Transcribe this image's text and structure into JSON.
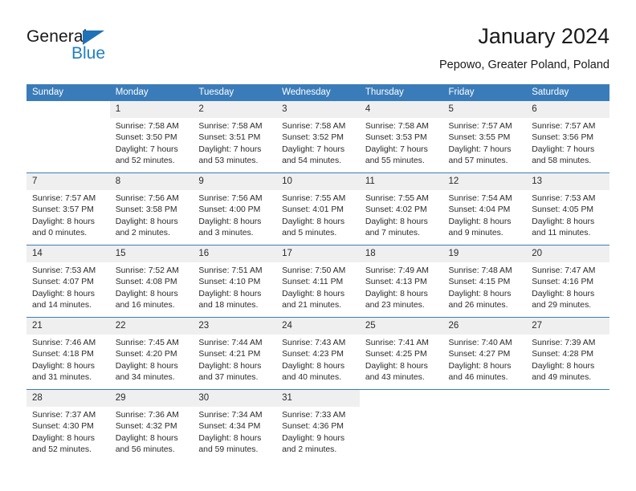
{
  "brand": {
    "name_part1": "General",
    "name_part2": "Blue",
    "triangle_icon": "triangle-icon",
    "accent_color": "#1f7fc4"
  },
  "header": {
    "title": "January 2024",
    "subtitle": "Pepowo, Greater Poland, Poland"
  },
  "theme": {
    "header_row_color": "#3a7cb9",
    "daynum_band_color": "#efefef",
    "text_color": "#2a2a2a"
  },
  "calendar": {
    "weekday_headers": [
      "Sunday",
      "Monday",
      "Tuesday",
      "Wednesday",
      "Thursday",
      "Friday",
      "Saturday"
    ],
    "weeks": [
      [
        {
          "empty": true
        },
        {
          "day": "1",
          "sunrise": "Sunrise: 7:58 AM",
          "sunset": "Sunset: 3:50 PM",
          "daylight_line1": "Daylight: 7 hours",
          "daylight_line2": "and 52 minutes."
        },
        {
          "day": "2",
          "sunrise": "Sunrise: 7:58 AM",
          "sunset": "Sunset: 3:51 PM",
          "daylight_line1": "Daylight: 7 hours",
          "daylight_line2": "and 53 minutes."
        },
        {
          "day": "3",
          "sunrise": "Sunrise: 7:58 AM",
          "sunset": "Sunset: 3:52 PM",
          "daylight_line1": "Daylight: 7 hours",
          "daylight_line2": "and 54 minutes."
        },
        {
          "day": "4",
          "sunrise": "Sunrise: 7:58 AM",
          "sunset": "Sunset: 3:53 PM",
          "daylight_line1": "Daylight: 7 hours",
          "daylight_line2": "and 55 minutes."
        },
        {
          "day": "5",
          "sunrise": "Sunrise: 7:57 AM",
          "sunset": "Sunset: 3:55 PM",
          "daylight_line1": "Daylight: 7 hours",
          "daylight_line2": "and 57 minutes."
        },
        {
          "day": "6",
          "sunrise": "Sunrise: 7:57 AM",
          "sunset": "Sunset: 3:56 PM",
          "daylight_line1": "Daylight: 7 hours",
          "daylight_line2": "and 58 minutes."
        }
      ],
      [
        {
          "day": "7",
          "sunrise": "Sunrise: 7:57 AM",
          "sunset": "Sunset: 3:57 PM",
          "daylight_line1": "Daylight: 8 hours",
          "daylight_line2": "and 0 minutes."
        },
        {
          "day": "8",
          "sunrise": "Sunrise: 7:56 AM",
          "sunset": "Sunset: 3:58 PM",
          "daylight_line1": "Daylight: 8 hours",
          "daylight_line2": "and 2 minutes."
        },
        {
          "day": "9",
          "sunrise": "Sunrise: 7:56 AM",
          "sunset": "Sunset: 4:00 PM",
          "daylight_line1": "Daylight: 8 hours",
          "daylight_line2": "and 3 minutes."
        },
        {
          "day": "10",
          "sunrise": "Sunrise: 7:55 AM",
          "sunset": "Sunset: 4:01 PM",
          "daylight_line1": "Daylight: 8 hours",
          "daylight_line2": "and 5 minutes."
        },
        {
          "day": "11",
          "sunrise": "Sunrise: 7:55 AM",
          "sunset": "Sunset: 4:02 PM",
          "daylight_line1": "Daylight: 8 hours",
          "daylight_line2": "and 7 minutes."
        },
        {
          "day": "12",
          "sunrise": "Sunrise: 7:54 AM",
          "sunset": "Sunset: 4:04 PM",
          "daylight_line1": "Daylight: 8 hours",
          "daylight_line2": "and 9 minutes."
        },
        {
          "day": "13",
          "sunrise": "Sunrise: 7:53 AM",
          "sunset": "Sunset: 4:05 PM",
          "daylight_line1": "Daylight: 8 hours",
          "daylight_line2": "and 11 minutes."
        }
      ],
      [
        {
          "day": "14",
          "sunrise": "Sunrise: 7:53 AM",
          "sunset": "Sunset: 4:07 PM",
          "daylight_line1": "Daylight: 8 hours",
          "daylight_line2": "and 14 minutes."
        },
        {
          "day": "15",
          "sunrise": "Sunrise: 7:52 AM",
          "sunset": "Sunset: 4:08 PM",
          "daylight_line1": "Daylight: 8 hours",
          "daylight_line2": "and 16 minutes."
        },
        {
          "day": "16",
          "sunrise": "Sunrise: 7:51 AM",
          "sunset": "Sunset: 4:10 PM",
          "daylight_line1": "Daylight: 8 hours",
          "daylight_line2": "and 18 minutes."
        },
        {
          "day": "17",
          "sunrise": "Sunrise: 7:50 AM",
          "sunset": "Sunset: 4:11 PM",
          "daylight_line1": "Daylight: 8 hours",
          "daylight_line2": "and 21 minutes."
        },
        {
          "day": "18",
          "sunrise": "Sunrise: 7:49 AM",
          "sunset": "Sunset: 4:13 PM",
          "daylight_line1": "Daylight: 8 hours",
          "daylight_line2": "and 23 minutes."
        },
        {
          "day": "19",
          "sunrise": "Sunrise: 7:48 AM",
          "sunset": "Sunset: 4:15 PM",
          "daylight_line1": "Daylight: 8 hours",
          "daylight_line2": "and 26 minutes."
        },
        {
          "day": "20",
          "sunrise": "Sunrise: 7:47 AM",
          "sunset": "Sunset: 4:16 PM",
          "daylight_line1": "Daylight: 8 hours",
          "daylight_line2": "and 29 minutes."
        }
      ],
      [
        {
          "day": "21",
          "sunrise": "Sunrise: 7:46 AM",
          "sunset": "Sunset: 4:18 PM",
          "daylight_line1": "Daylight: 8 hours",
          "daylight_line2": "and 31 minutes."
        },
        {
          "day": "22",
          "sunrise": "Sunrise: 7:45 AM",
          "sunset": "Sunset: 4:20 PM",
          "daylight_line1": "Daylight: 8 hours",
          "daylight_line2": "and 34 minutes."
        },
        {
          "day": "23",
          "sunrise": "Sunrise: 7:44 AM",
          "sunset": "Sunset: 4:21 PM",
          "daylight_line1": "Daylight: 8 hours",
          "daylight_line2": "and 37 minutes."
        },
        {
          "day": "24",
          "sunrise": "Sunrise: 7:43 AM",
          "sunset": "Sunset: 4:23 PM",
          "daylight_line1": "Daylight: 8 hours",
          "daylight_line2": "and 40 minutes."
        },
        {
          "day": "25",
          "sunrise": "Sunrise: 7:41 AM",
          "sunset": "Sunset: 4:25 PM",
          "daylight_line1": "Daylight: 8 hours",
          "daylight_line2": "and 43 minutes."
        },
        {
          "day": "26",
          "sunrise": "Sunrise: 7:40 AM",
          "sunset": "Sunset: 4:27 PM",
          "daylight_line1": "Daylight: 8 hours",
          "daylight_line2": "and 46 minutes."
        },
        {
          "day": "27",
          "sunrise": "Sunrise: 7:39 AM",
          "sunset": "Sunset: 4:28 PM",
          "daylight_line1": "Daylight: 8 hours",
          "daylight_line2": "and 49 minutes."
        }
      ],
      [
        {
          "day": "28",
          "sunrise": "Sunrise: 7:37 AM",
          "sunset": "Sunset: 4:30 PM",
          "daylight_line1": "Daylight: 8 hours",
          "daylight_line2": "and 52 minutes."
        },
        {
          "day": "29",
          "sunrise": "Sunrise: 7:36 AM",
          "sunset": "Sunset: 4:32 PM",
          "daylight_line1": "Daylight: 8 hours",
          "daylight_line2": "and 56 minutes."
        },
        {
          "day": "30",
          "sunrise": "Sunrise: 7:34 AM",
          "sunset": "Sunset: 4:34 PM",
          "daylight_line1": "Daylight: 8 hours",
          "daylight_line2": "and 59 minutes."
        },
        {
          "day": "31",
          "sunrise": "Sunrise: 7:33 AM",
          "sunset": "Sunset: 4:36 PM",
          "daylight_line1": "Daylight: 9 hours",
          "daylight_line2": "and 2 minutes."
        },
        {
          "empty": true
        },
        {
          "empty": true
        },
        {
          "empty": true
        }
      ]
    ]
  }
}
